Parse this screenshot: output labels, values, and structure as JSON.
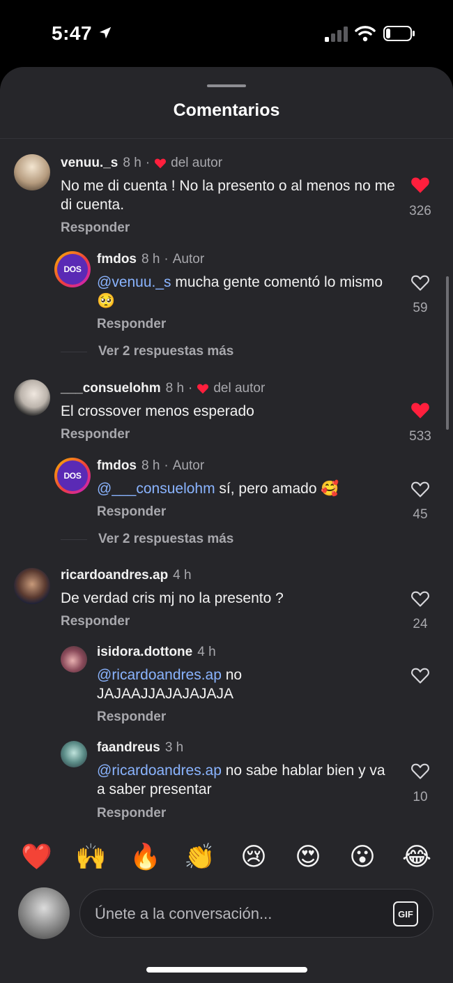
{
  "status_bar": {
    "time": "5:47"
  },
  "sheet": {
    "title": "Comentarios"
  },
  "comments": [
    {
      "user": "venuu._s",
      "time": "8 h",
      "badge": "del autor",
      "text": "No me di cuenta ! No la presento o al menos no me di cuenta.",
      "reply_label": "Responder",
      "likes": "326",
      "liked": true,
      "replies": [
        {
          "user": "fmdos",
          "time": "8 h",
          "badge": "Autor",
          "mention": "@venuu._s",
          "text": " mucha gente comentó lo mismo 🥺",
          "reply_label": "Responder",
          "likes": "59",
          "liked": false
        }
      ],
      "more_replies": "Ver 2 respuestas más"
    },
    {
      "user": "___consuelohm",
      "time": "8 h",
      "badge": "del autor",
      "text": "El crossover menos esperado",
      "reply_label": "Responder",
      "likes": "533",
      "liked": true,
      "replies": [
        {
          "user": "fmdos",
          "time": "8 h",
          "badge": "Autor",
          "mention": "@___consuelohm",
          "text": " sí, pero amado 🥰",
          "reply_label": "Responder",
          "likes": "45",
          "liked": false
        }
      ],
      "more_replies": "Ver 2 respuestas más"
    },
    {
      "user": "ricardoandres.ap",
      "time": "4 h",
      "text": "De verdad cris mj no la presento ?",
      "reply_label": "Responder",
      "likes": "24",
      "liked": false,
      "replies": [
        {
          "user": "isidora.dottone",
          "time": "4 h",
          "mention": "@ricardoandres.ap",
          "text": " no JAJAAJJAJAJAJAJA",
          "reply_label": "Responder",
          "likes": "",
          "liked": false
        },
        {
          "user": "faandreus",
          "time": "3 h",
          "mention": "@ricardoandres.ap",
          "text": " no sabe hablar bien y va a saber presentar",
          "reply_label": "Responder",
          "likes": "10",
          "liked": false
        }
      ]
    }
  ],
  "brand_avatar_text": "DOS",
  "emoji_bar": [
    "❤️",
    "🙌",
    "🔥",
    "👏",
    "😢",
    "😍",
    "😮",
    "😂"
  ],
  "composer": {
    "placeholder": "Únete a la conversación...",
    "gif_label": "GIF"
  },
  "colors": {
    "like_red": "#ff1f3d",
    "mention_blue": "#8ab4ff",
    "sheet_bg": "#26262a"
  }
}
